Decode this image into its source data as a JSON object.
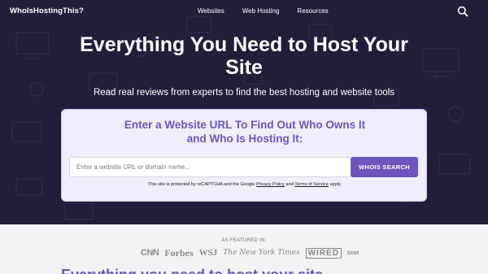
{
  "nav": {
    "logo": "WhoIsHostingThis?",
    "links": [
      "Websites",
      "Web Hosting",
      "Resources"
    ],
    "search_icon": "search-icon"
  },
  "hero": {
    "title": "Everything You Need to Host Your Site",
    "subtitle": "Read real reviews from experts to find the best hosting and website tools"
  },
  "search_card": {
    "title_line1": "Enter a Website URL To Find Out Who Owns It",
    "title_line2": "and Who Is Hosting It:",
    "input_placeholder": "Enter a website URL or domain name...",
    "input_value": "",
    "button_label": "WHOIS SEARCH",
    "note_prefix": "This site is protected by reCAPTCHA and the Google",
    "privacy_link": "Privacy Policy",
    "note_and": "and",
    "terms_link": "Terms of Service",
    "note_suffix": "apply."
  },
  "featured": {
    "label": "AS FEATURED IN:",
    "logos": [
      "CNN",
      "Forbes",
      "WSJ",
      "The New York Times",
      "WIRED",
      "cnet"
    ]
  },
  "section": {
    "title": "Everything you need to host your site"
  },
  "colors": {
    "hero_bg": "#231d3a",
    "accent": "#6b56bd",
    "card_bg": "#eeeefc"
  }
}
